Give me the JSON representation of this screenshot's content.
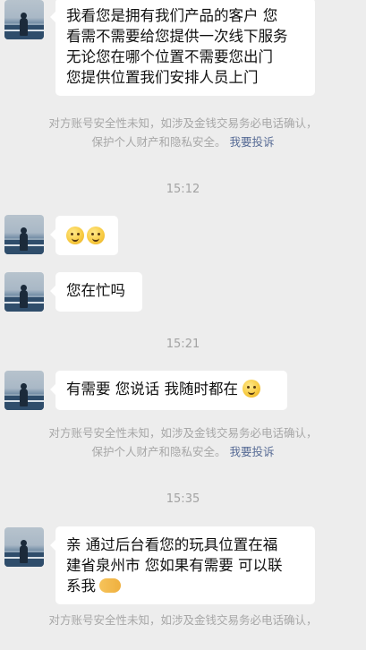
{
  "messages": [
    {
      "type": "received",
      "lines": [
        "我看您是拥有我们产品的客户 您",
        "看需不需要给您提供一次线下服务",
        "无论您在哪个位置不需要您出门",
        "您提供位置我们安排人员上门"
      ]
    },
    {
      "type": "notice",
      "line1": "对方账号安全性未知，如涉及金钱交易务必电话确认，",
      "line2": "保护个人财产和隐私安全。",
      "link": "我要投诉"
    },
    {
      "type": "time",
      "text": "15:12"
    },
    {
      "type": "received",
      "emoji": [
        "thinking-face-emoji",
        "thinking-face-emoji"
      ]
    },
    {
      "type": "received",
      "text": "您在忙吗"
    },
    {
      "type": "time",
      "text": "15:21"
    },
    {
      "type": "received",
      "text": "有需要 您说话 我随时都在",
      "emoji": "smile-emoji"
    },
    {
      "type": "notice",
      "line1": "对方账号安全性未知，如涉及金钱交易务必电话确认，",
      "line2": "保护个人财产和隐私安全。",
      "link": "我要投诉"
    },
    {
      "type": "time",
      "text": "15:35"
    },
    {
      "type": "received",
      "lines": [
        "亲 通过后台看您的玩具位置在福",
        "建省泉州市 您如果有需要 可以联",
        "系我"
      ],
      "emoji": "handshake-emoji"
    },
    {
      "type": "notice",
      "line1": "对方账号安全性未知，如涉及金钱交易务必电话确认，"
    }
  ]
}
